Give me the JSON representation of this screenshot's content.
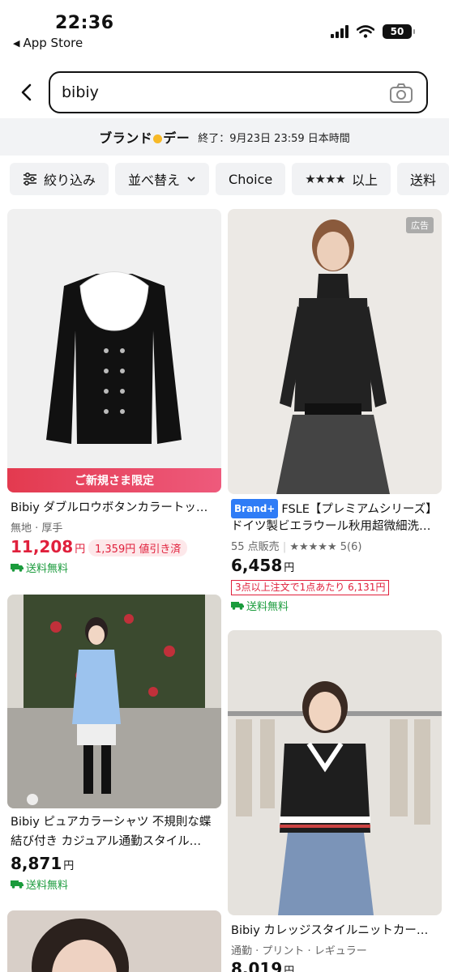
{
  "status_bar": {
    "time": "22:36",
    "back_app": "App Store",
    "battery": "50"
  },
  "search": {
    "query": "bibiy"
  },
  "promo": {
    "brand_prefix": "ブランド",
    "brand_suffix": "デー",
    "end_text": "終了：9月23日 23:59 日本時間"
  },
  "filters": [
    {
      "label": "絞り込み",
      "icon": "sliders-icon"
    },
    {
      "label": "並べ替え",
      "icon": "chevron-down-icon"
    },
    {
      "label": "Choice"
    },
    {
      "label": "以上",
      "stars": "★★★★"
    },
    {
      "label": "送料"
    }
  ],
  "products": [
    {
      "promo_strip": "ご新規さま限定",
      "title": "Bibiy ダブルロウボタンカラートッ…",
      "tags": "無地 · 厚手",
      "price": "11,208",
      "currency": "円",
      "discount": "1,359円 値引き済",
      "shipping": "送料無料"
    },
    {
      "ad_badge": "広告",
      "brand_badge": "Brand+",
      "title_line1": "FSLE【プレミアムシリーズ】",
      "title_line2": "ドイツ製ビエラウール秋用超微細洗…",
      "sold": "55 点販売",
      "stars": "★★★★★",
      "rating": "5",
      "rating_count": "(6)",
      "price": "6,458",
      "currency": "円",
      "bulk": "3点以上注文で1点あたり 6,131円",
      "shipping": "送料無料"
    },
    {
      "title_line1": "Bibiy ピュアカラーシャツ 不規則な蝶",
      "title_line2": "結び付き カジュアル通勤スタイル…",
      "price": "8,871",
      "currency": "円",
      "shipping": "送料無料"
    },
    {
      "title": "Bibiy カレッジスタイルニットカー…",
      "tags": "通勤 · プリント · レギュラー",
      "price": "8,019",
      "currency": "円"
    }
  ],
  "colors": {
    "price_red": "#e0203c",
    "shipping_green": "#1a9b3c",
    "brand_blue": "#2f7cf6"
  }
}
